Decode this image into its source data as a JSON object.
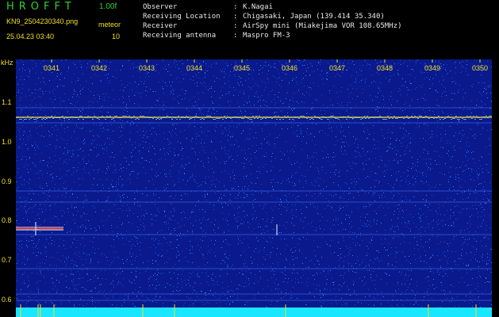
{
  "header": {
    "app_title": "HROFFT",
    "version": "1.00f",
    "file_name": "KN9_2504230340.png",
    "meteor_label": "meteor",
    "timestamp": "25.04.23 03:40",
    "meteor_count": "10",
    "info": [
      {
        "label": "Observer",
        "value": "K.Nagai"
      },
      {
        "label": "Receiving Location",
        "value": "Chigasaki, Japan (139.414 35.340)"
      },
      {
        "label": "Receiver",
        "value": "AirSpy mini (Miakejima VOR 108.65MHz)"
      },
      {
        "label": "Receiving antenna",
        "value": "Maspro FM-3"
      }
    ],
    "separator": ":"
  },
  "spectrogram": {
    "unit_label": "kHz",
    "x_ticks": [
      "0341",
      "0342",
      "0343",
      "0344",
      "0345",
      "0346",
      "0347",
      "0348",
      "0349",
      "0350"
    ],
    "y_ticks": [
      "1.1",
      "1.0",
      "0.9",
      "0.8",
      "0.7",
      "0.6"
    ],
    "colors": {
      "background": "#0a1a8c",
      "noise_bright": "#2f7cff",
      "carrier": "#ffd24a",
      "echo": "#ff3030",
      "bottom_band": "#19e6ff",
      "tick": "#f0e020"
    }
  }
}
